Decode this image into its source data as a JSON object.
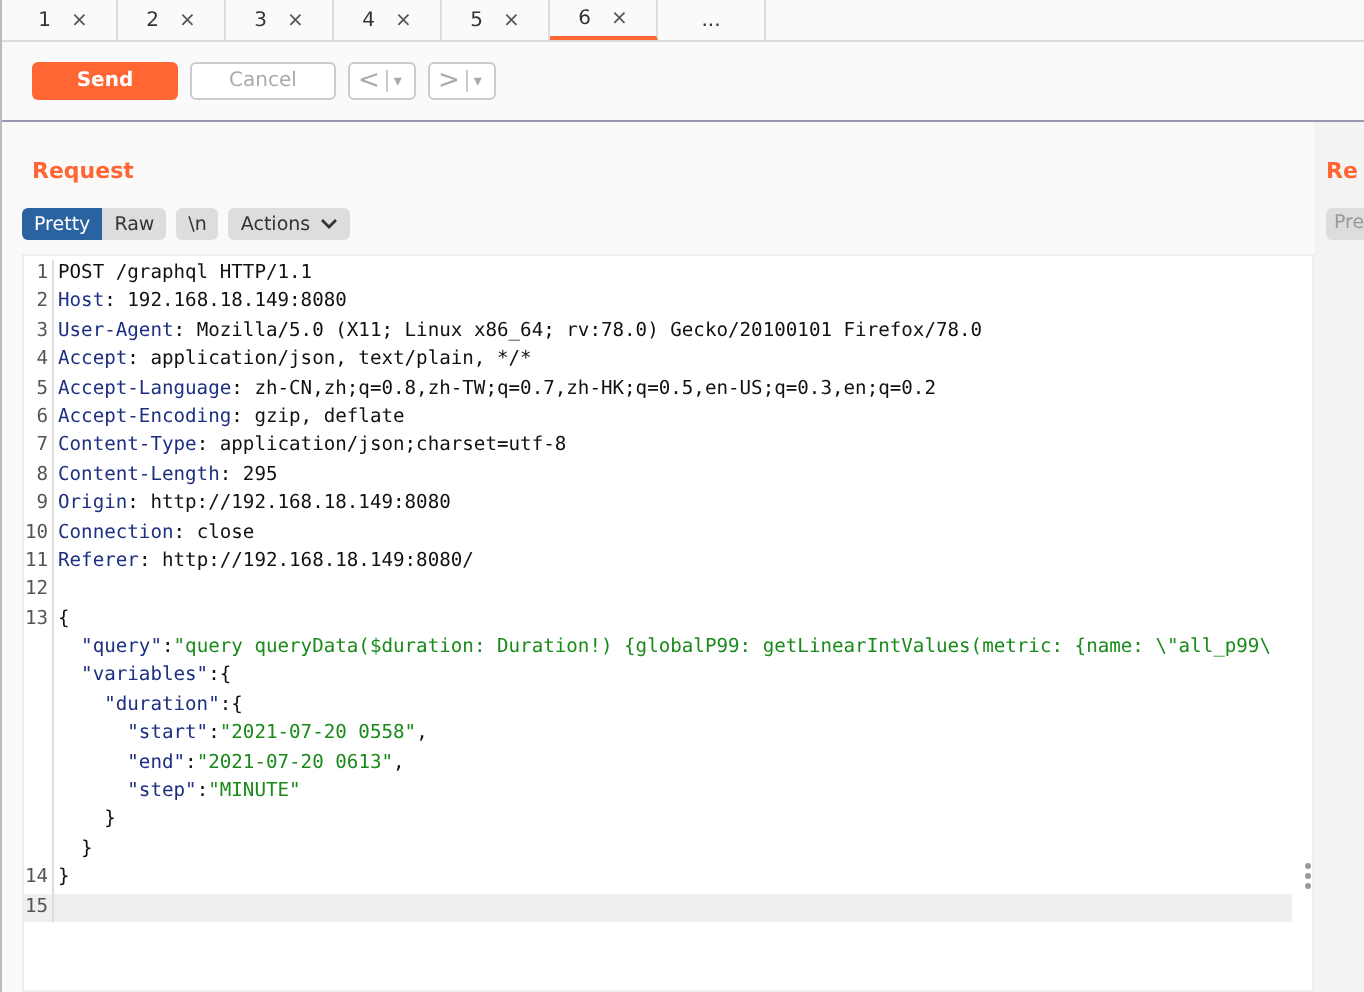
{
  "tabs": [
    {
      "label": "1",
      "close": "×",
      "selected": false
    },
    {
      "label": "2",
      "close": "×",
      "selected": false
    },
    {
      "label": "3",
      "close": "×",
      "selected": false
    },
    {
      "label": "4",
      "close": "×",
      "selected": false
    },
    {
      "label": "5",
      "close": "×",
      "selected": false
    },
    {
      "label": "6",
      "close": "×",
      "selected": true
    },
    {
      "label": "...",
      "selected": false
    }
  ],
  "toolbar": {
    "send": "Send",
    "cancel": "Cancel",
    "back": {
      "symbol": "<",
      "caret": "▾"
    },
    "forward": {
      "symbol": ">",
      "caret": "▾"
    }
  },
  "request": {
    "title": "Request",
    "view_tabs": [
      {
        "label": "Pretty",
        "selected": true
      },
      {
        "label": "Raw",
        "selected": false
      },
      {
        "label": "\\n",
        "selected": false
      }
    ],
    "actions": "Actions",
    "lines": [
      {
        "number": "1",
        "segments": [
          {
            "kind": "plain",
            "text": "POST /graphql HTTP/1.1"
          }
        ]
      },
      {
        "number": "2",
        "segments": [
          {
            "kind": "name",
            "text": "Host"
          },
          {
            "kind": "plain",
            "text": ": 192.168.18.149:8080"
          }
        ]
      },
      {
        "number": "3",
        "segments": [
          {
            "kind": "name",
            "text": "User-Agent"
          },
          {
            "kind": "plain",
            "text": ": Mozilla/5.0 (X11; Linux x86_64; rv:78.0) Gecko/20100101 Firefox/78.0"
          }
        ]
      },
      {
        "number": "4",
        "segments": [
          {
            "kind": "name",
            "text": "Accept"
          },
          {
            "kind": "plain",
            "text": ": application/json, text/plain, */*"
          }
        ]
      },
      {
        "number": "5",
        "segments": [
          {
            "kind": "name",
            "text": "Accept-Language"
          },
          {
            "kind": "plain",
            "text": ": zh-CN,zh;q=0.8,zh-TW;q=0.7,zh-HK;q=0.5,en-US;q=0.3,en;q=0.2"
          }
        ]
      },
      {
        "number": "6",
        "segments": [
          {
            "kind": "name",
            "text": "Accept-Encoding"
          },
          {
            "kind": "plain",
            "text": ": gzip, deflate"
          }
        ]
      },
      {
        "number": "7",
        "segments": [
          {
            "kind": "name",
            "text": "Content-Type"
          },
          {
            "kind": "plain",
            "text": ": application/json;charset=utf-8"
          }
        ]
      },
      {
        "number": "8",
        "segments": [
          {
            "kind": "name",
            "text": "Content-Length"
          },
          {
            "kind": "plain",
            "text": ": 295"
          }
        ]
      },
      {
        "number": "9",
        "segments": [
          {
            "kind": "name",
            "text": "Origin"
          },
          {
            "kind": "plain",
            "text": ": http://192.168.18.149:8080"
          }
        ]
      },
      {
        "number": "10",
        "segments": [
          {
            "kind": "name",
            "text": "Connection"
          },
          {
            "kind": "plain",
            "text": ": close"
          }
        ]
      },
      {
        "number": "11",
        "segments": [
          {
            "kind": "name",
            "text": "Referer"
          },
          {
            "kind": "plain",
            "text": ": http://192.168.18.149:8080/"
          }
        ]
      },
      {
        "number": "12"
      },
      {
        "number": "13",
        "segments": [
          {
            "kind": "plain",
            "text": "{"
          }
        ]
      },
      {
        "segments": [
          {
            "kind": "name",
            "text": "  \"query\""
          },
          {
            "kind": "plain",
            "text": ":"
          },
          {
            "kind": "string",
            "text": "\"query queryData($duration: Duration!) {globalP99: getLinearIntValues(metric: {name: \\\"all_p99\\"
          }
        ]
      },
      {
        "segments": [
          {
            "kind": "name",
            "text": "  \"variables\""
          },
          {
            "kind": "plain",
            "text": ":{"
          }
        ]
      },
      {
        "segments": [
          {
            "kind": "name",
            "text": "    \"duration\""
          },
          {
            "kind": "plain",
            "text": ":{"
          }
        ]
      },
      {
        "segments": [
          {
            "kind": "name",
            "text": "      \"start\""
          },
          {
            "kind": "plain",
            "text": ":"
          },
          {
            "kind": "string",
            "text": "\"2021-07-20 0558\""
          },
          {
            "kind": "plain",
            "text": ","
          }
        ]
      },
      {
        "segments": [
          {
            "kind": "name",
            "text": "      \"end\""
          },
          {
            "kind": "plain",
            "text": ":"
          },
          {
            "kind": "string",
            "text": "\"2021-07-20 0613\""
          },
          {
            "kind": "plain",
            "text": ","
          }
        ]
      },
      {
        "segments": [
          {
            "kind": "name",
            "text": "      \"step\""
          },
          {
            "kind": "plain",
            "text": ":"
          },
          {
            "kind": "string",
            "text": "\"MINUTE\""
          }
        ]
      },
      {
        "segments": [
          {
            "kind": "plain",
            "text": "    }"
          }
        ]
      },
      {
        "segments": [
          {
            "kind": "plain",
            "text": "  }"
          }
        ]
      },
      {
        "number": "14",
        "segments": [
          {
            "kind": "plain",
            "text": "}"
          }
        ]
      },
      {
        "number": "15",
        "current": true
      }
    ]
  },
  "response": {
    "title": "Re",
    "view_tab": "Pre"
  }
}
